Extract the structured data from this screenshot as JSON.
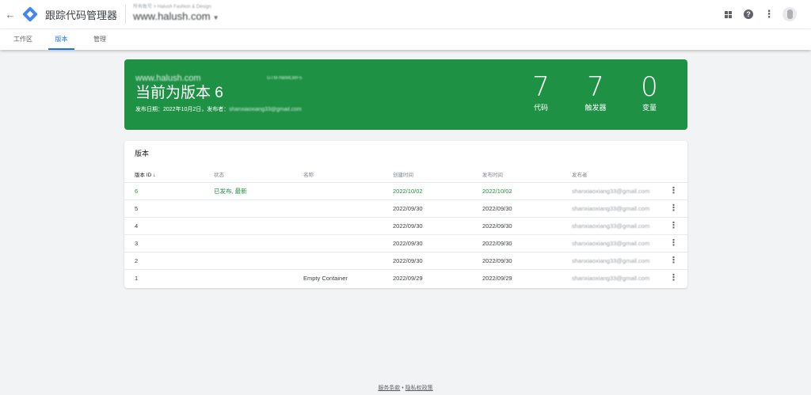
{
  "app": {
    "title": "跟踪代码管理器"
  },
  "account": {
    "path": "所有账号 > Halush Fashion & Design",
    "container_name": "www.halush.com"
  },
  "tabs": [
    {
      "label": "工作区",
      "active": false
    },
    {
      "label": "版本",
      "active": true
    },
    {
      "label": "管理",
      "active": false
    }
  ],
  "hero": {
    "domain": "www.halush.com",
    "container_id": "GTM-NBMLWF5",
    "title": "当前为版本 6",
    "meta_prefix": "发布日期：2022年10月2日，发布者：",
    "meta_email": "shanxiaoxiang33@gmail.com",
    "stats": [
      {
        "value": "7",
        "label": "代码"
      },
      {
        "value": "7",
        "label": "触发器"
      },
      {
        "value": "0",
        "label": "变量"
      }
    ],
    "color": "#1e9145"
  },
  "versions": {
    "title": "版本",
    "headers": {
      "id": "版本 ID ↓",
      "status": "状态",
      "name": "名称",
      "created": "创建时间",
      "published": "发布时间",
      "publisher": "发布者"
    },
    "rows": [
      {
        "id": "6",
        "status": "已发布, 最新",
        "name": "",
        "created": "2022/10/02",
        "published": "2022/10/02",
        "publisher": "shanxiaoxiang33@gmail.com"
      },
      {
        "id": "5",
        "status": "",
        "name": "",
        "created": "2022/09/30",
        "published": "2022/09/30",
        "publisher": "shanxiaoxiang33@gmail.com"
      },
      {
        "id": "4",
        "status": "",
        "name": "",
        "created": "2022/09/30",
        "published": "2022/09/30",
        "publisher": "shanxiaoxiang33@gmail.com"
      },
      {
        "id": "3",
        "status": "",
        "name": "",
        "created": "2022/09/30",
        "published": "2022/09/30",
        "publisher": "shanxiaoxiang33@gmail.com"
      },
      {
        "id": "2",
        "status": "",
        "name": "",
        "created": "2022/09/30",
        "published": "2022/09/30",
        "publisher": "shanxiaoxiang33@gmail.com"
      },
      {
        "id": "1",
        "status": "",
        "name": "Empty Container",
        "created": "2022/09/29",
        "published": "2022/09/29",
        "publisher": "shanxiaoxiang33@gmail.com"
      }
    ]
  },
  "footer": {
    "terms": "服务条款",
    "separator": "•",
    "privacy": "隐私权政策"
  },
  "icons": {
    "back": "back-arrow-icon",
    "logo": "gtm-logo-icon",
    "apps": "apps-grid-icon",
    "help": "help-icon",
    "more": "more-vert-icon",
    "row_menu": "more-vert-icon"
  }
}
